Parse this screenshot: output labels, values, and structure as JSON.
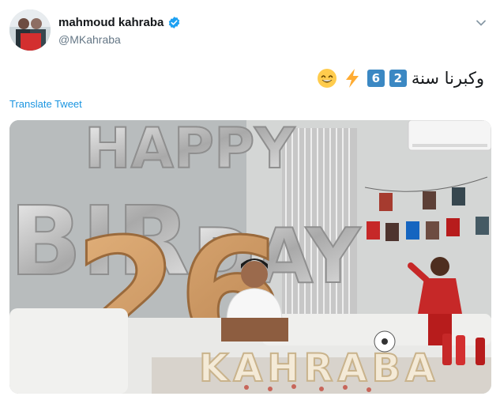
{
  "author": {
    "display_name": "mahmoud kahraba",
    "handle": "@MKahraba",
    "verified": true
  },
  "tweet": {
    "text": "وكبرنا سنة",
    "keycaps": [
      "2",
      "6"
    ],
    "emojis": [
      "high-voltage",
      "grinning-face-with-smiling-eyes"
    ]
  },
  "translate_label": "Translate Tweet",
  "photo": {
    "balloon_top": "HAPPY",
    "balloon_left": "BIR",
    "balloon_right": "DAY",
    "number_balloons": "26",
    "marquee": "KAHRABA"
  },
  "colors": {
    "link": "#1b95e0",
    "verified": "#1da1f2",
    "handle": "#657786",
    "keycap": "#3b88c3"
  }
}
